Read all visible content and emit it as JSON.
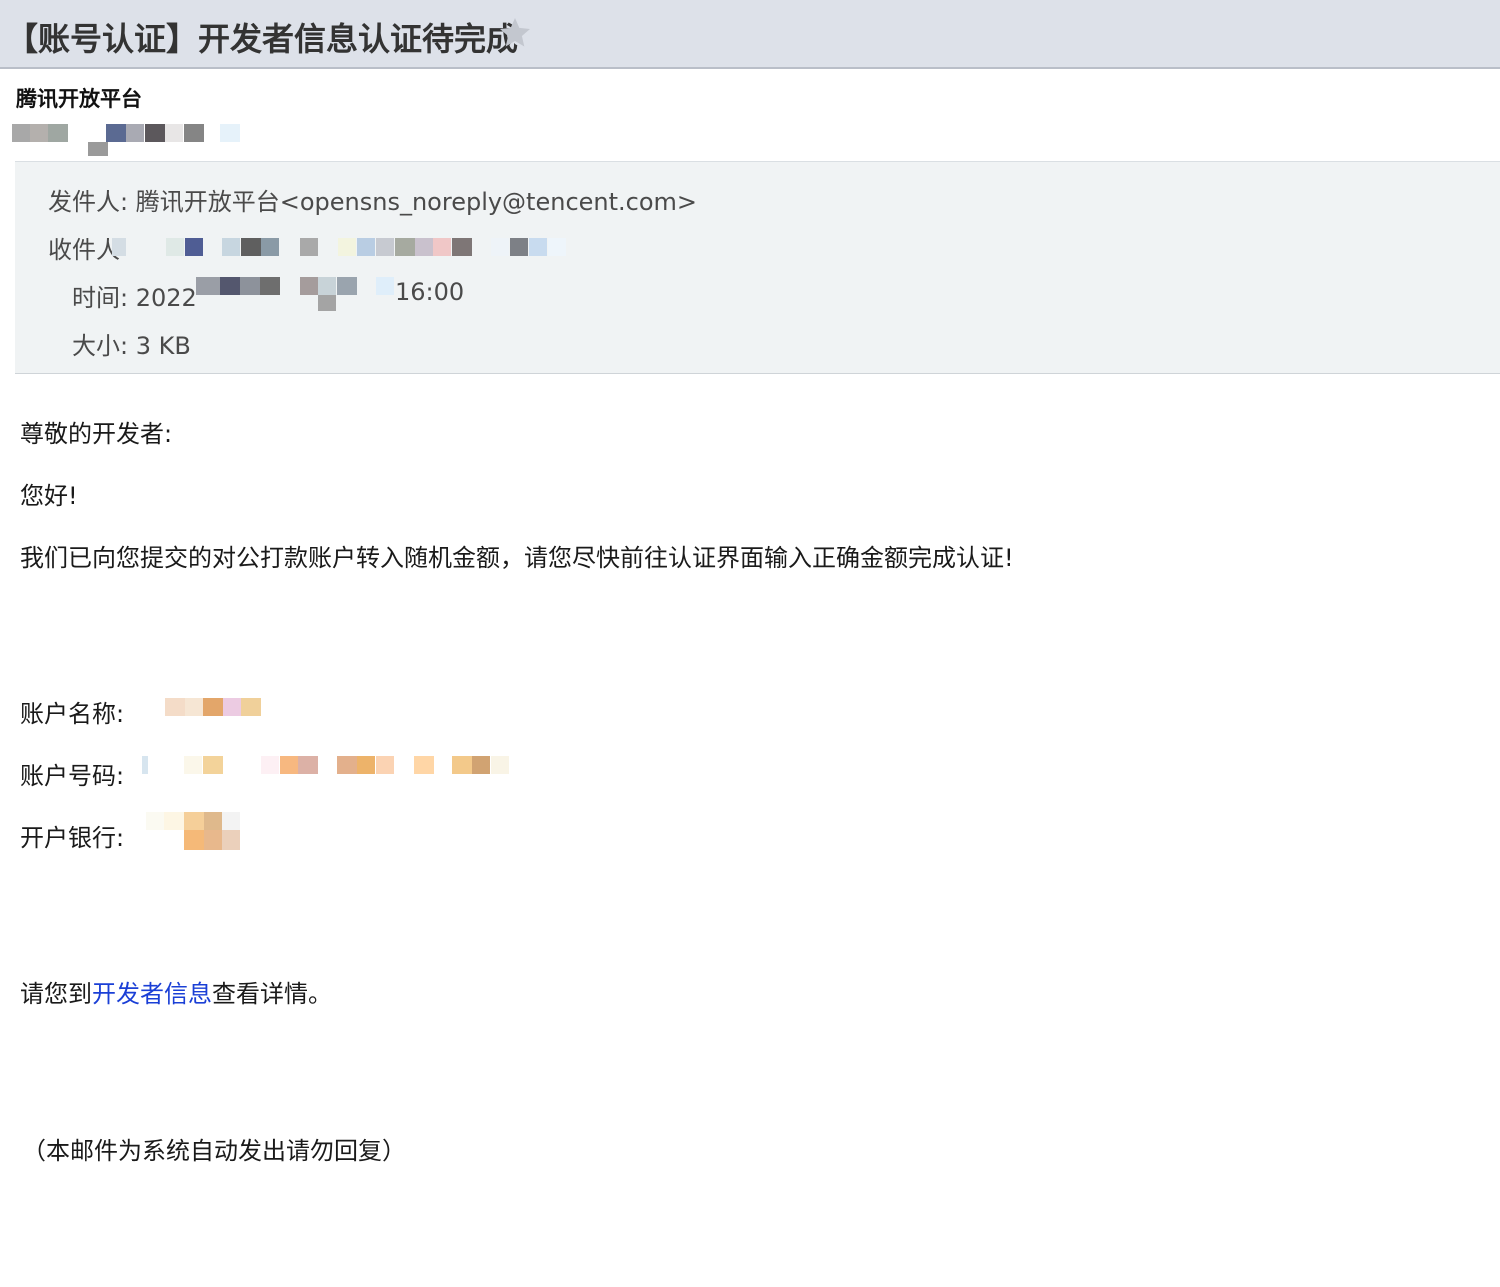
{
  "email": {
    "subject": "【账号认证】开发者信息认证待完成",
    "sender_name": "腾讯开放平台",
    "meta": {
      "from_label": "发件人:",
      "from_value": "腾讯开放平台<opensns_noreply@tencent.com>",
      "to_label": "收件人",
      "time_label": "时间:",
      "time_prefix": "2022",
      "time_suffix": "16:00",
      "size_label": "大小:",
      "size_value": "3 KB"
    },
    "body": {
      "greeting": "尊敬的开发者:",
      "hello": "您好!",
      "message": "我们已向您提交的对公打款账户转入随机金额，请您尽快前往认证界面输入正确金额完成认证!",
      "account_name_label": "账户名称:",
      "account_number_label": "账户号码:",
      "bank_label": "开户银行:",
      "details_prefix": "请您到",
      "details_link": "开发者信息",
      "details_suffix": "查看详情。",
      "footer_note": "（本邮件为系统自动发出请勿回复）"
    }
  },
  "icons": {
    "star": "star-icon"
  },
  "colors": {
    "subject_bar": "#dde1e9",
    "meta_panel": "#f0f3f4",
    "link": "#1a3fd6"
  }
}
